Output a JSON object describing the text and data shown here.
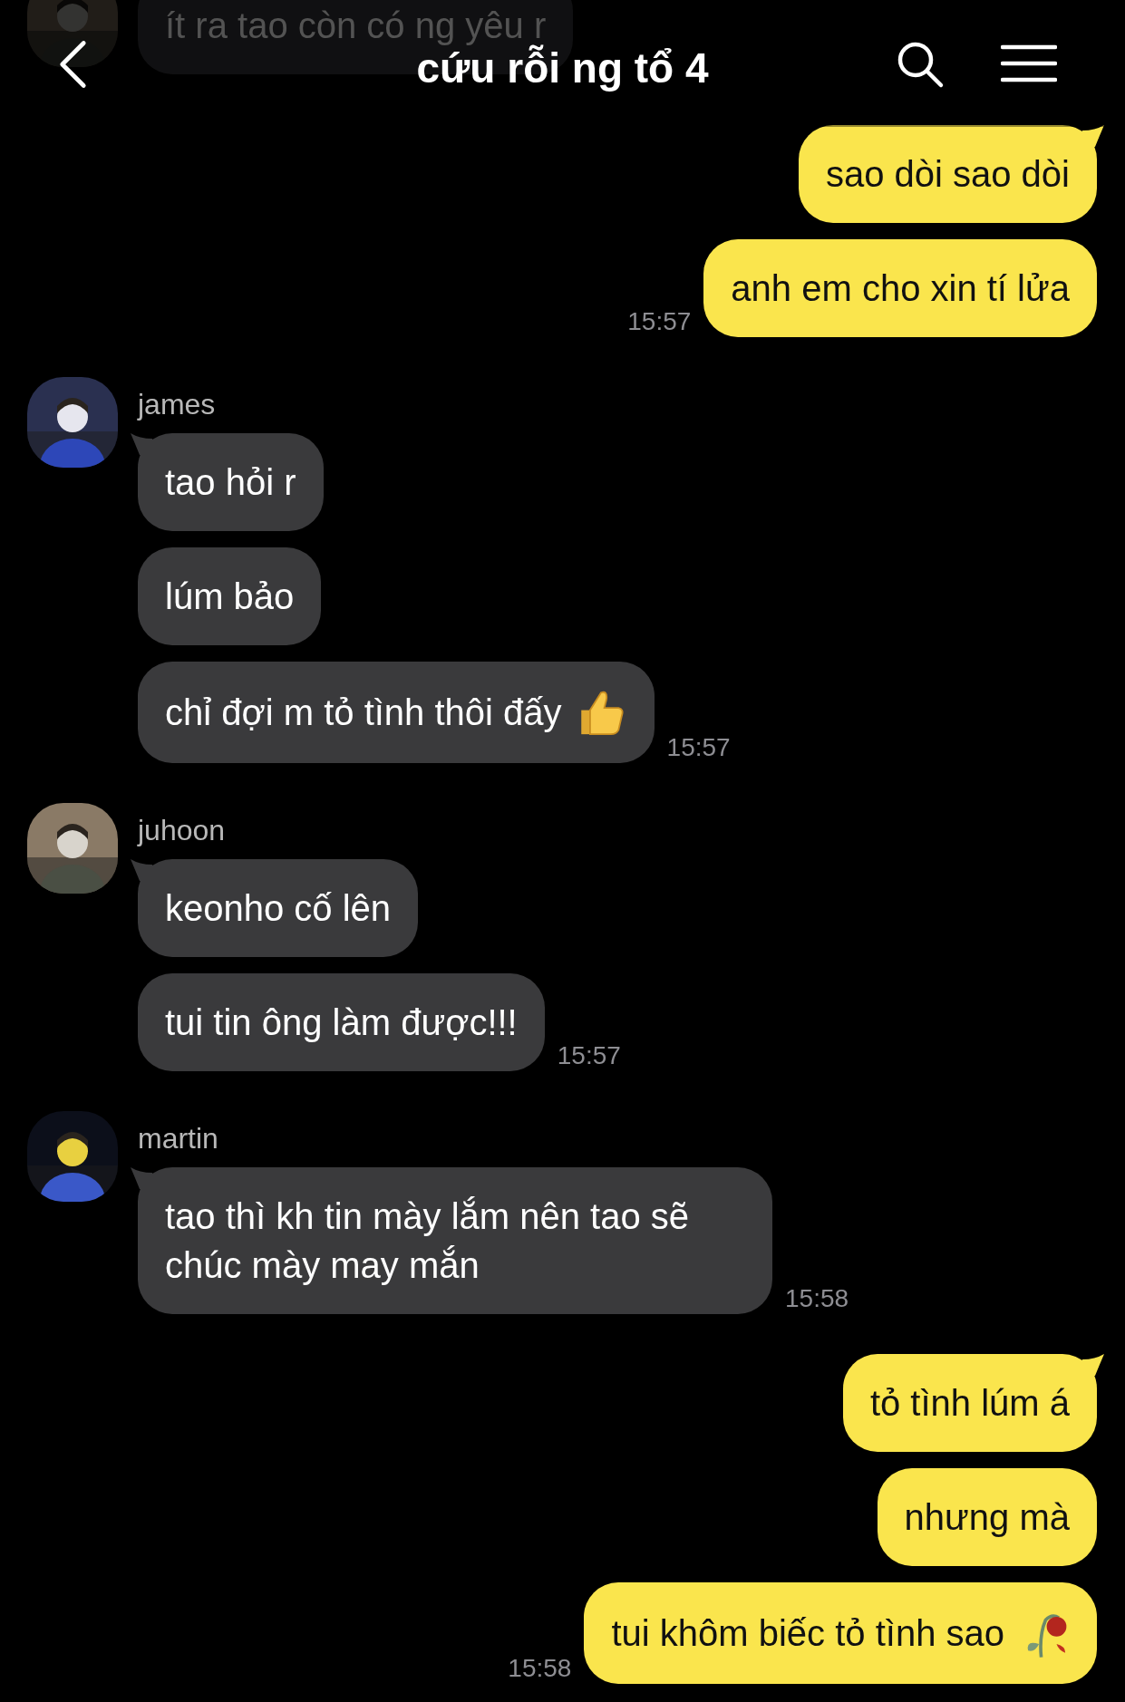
{
  "header": {
    "title": "cứu rỗi ng tổ 4"
  },
  "groups": [
    {
      "outgoing": false,
      "faded": true,
      "messages": [
        {
          "text": "ít ra tao còn có ng yêu r"
        }
      ]
    },
    {
      "outgoing": true,
      "faded": false,
      "time": "15:57",
      "messages": [
        {
          "text": "sao dòi sao dòi"
        },
        {
          "text": "anh em cho xin tí lửa"
        }
      ]
    },
    {
      "outgoing": false,
      "faded": false,
      "name": "james",
      "time": "15:57",
      "messages": [
        {
          "text": "tao hỏi r"
        },
        {
          "text": "lúm bảo"
        },
        {
          "text": "chỉ đợi m tỏ tình thôi đấy",
          "kind": "thumbsup"
        }
      ]
    },
    {
      "outgoing": false,
      "faded": false,
      "name": "juhoon",
      "time": "15:57",
      "messages": [
        {
          "text": "keonho cố lên"
        },
        {
          "text": "tui tin ông làm được!!!"
        }
      ]
    },
    {
      "outgoing": false,
      "faded": false,
      "name": "martin",
      "time": "15:58",
      "messages": [
        {
          "text": "tao thì kh tin mày lắm nên tao sẽ chúc mày may mắn"
        }
      ]
    },
    {
      "outgoing": true,
      "faded": false,
      "time": "15:58",
      "messages": [
        {
          "text": "tỏ tình lúm á"
        },
        {
          "text": "nhưng mà"
        },
        {
          "text": "tui khôm biếc tỏ tình sao",
          "kind": "rose"
        }
      ]
    }
  ]
}
